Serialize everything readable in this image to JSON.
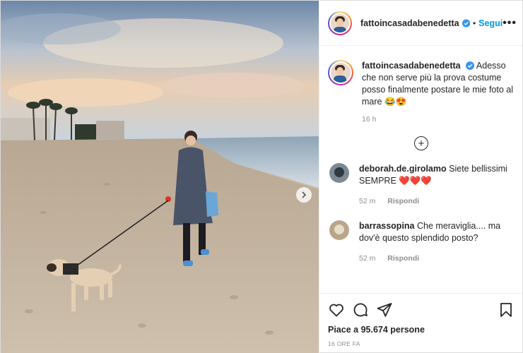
{
  "post": {
    "username": "fattoincasadabenedetta",
    "follow_label": "Segui",
    "more_label": "•••",
    "caption": "Adesso che non serve più la prova costume posso finalmente postare le mie foto al mare 😂😍",
    "caption_time": "16 h",
    "load_more_label": "+"
  },
  "comments": [
    {
      "user": "deborah.de.girolamo",
      "text": "Siete bellissimi SEMPRE ❤️❤️❤️",
      "time": "52 m",
      "reply": "Rispondi"
    },
    {
      "user": "barrassopina",
      "text": "Che meraviglia.... ma dov'è questo splendido posto?",
      "time": "52 m",
      "reply": "Rispondi"
    }
  ],
  "footer": {
    "likes": "Piace a 95.674 persone",
    "ago": "16 ORE FA"
  },
  "icons": [
    "heart-icon",
    "comment-icon",
    "share-icon",
    "bookmark-icon",
    "verified-badge-icon",
    "next-arrow-icon",
    "more-icon",
    "add-circle-icon"
  ],
  "colors": {
    "accent": "#0095f6",
    "verified": "#3897f0",
    "text": "#262626",
    "muted": "#8e8e8e"
  }
}
